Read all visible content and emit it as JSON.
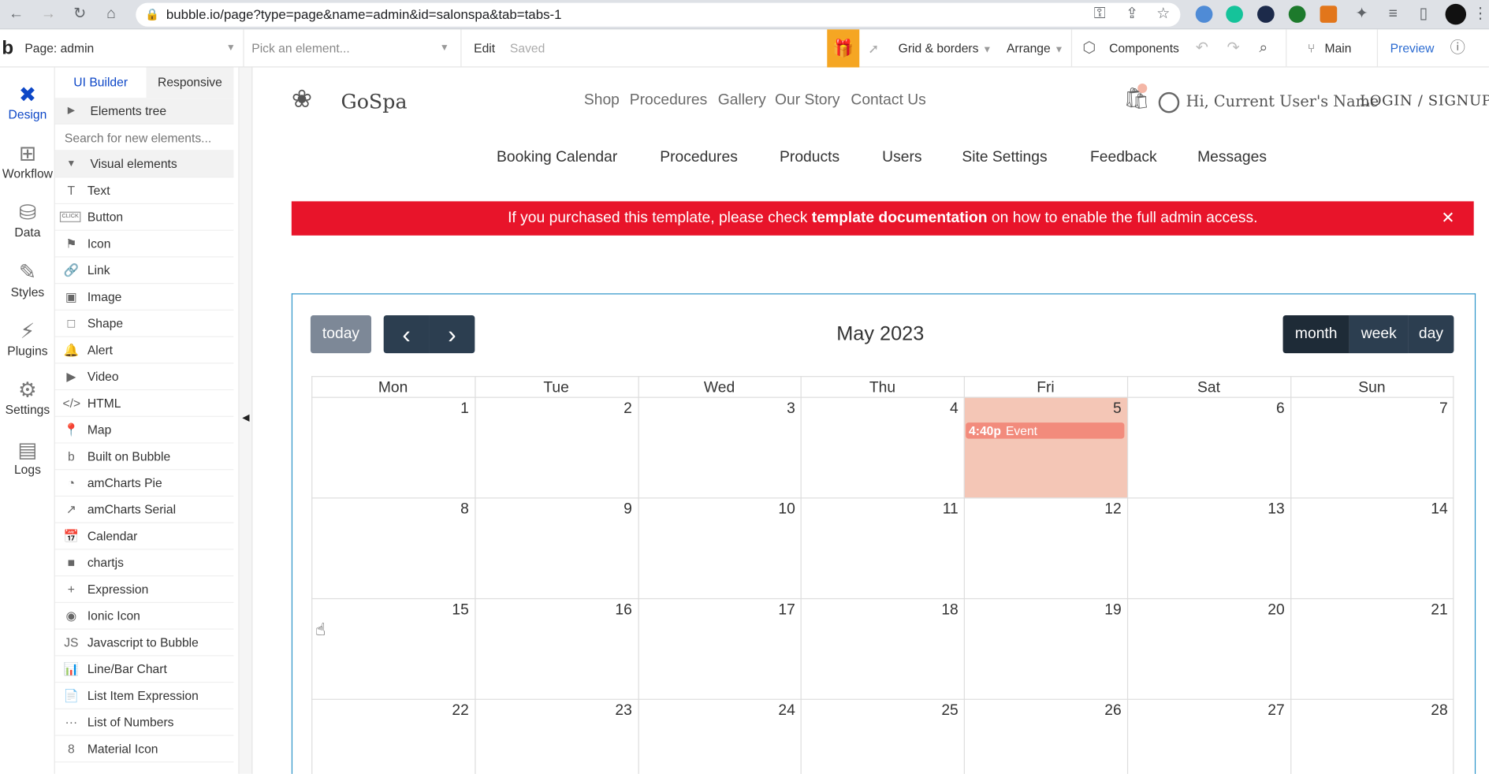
{
  "browser": {
    "url": "bubble.io/page?type=page&name=admin&id=salonspa&tab=tabs-1"
  },
  "toolbar": {
    "page_label": "Page: admin",
    "element_picker": "Pick an element...",
    "edit": "Edit",
    "saved": "Saved",
    "grid_borders": "Grid & borders",
    "arrange": "Arrange",
    "components": "Components",
    "branch": "Main",
    "preview": "Preview"
  },
  "leftnav": {
    "items": [
      "Design",
      "Workflow",
      "Data",
      "Styles",
      "Plugins",
      "Settings",
      "Logs"
    ]
  },
  "panel": {
    "tabs": [
      "UI Builder",
      "Responsive"
    ],
    "elements_tree": "Elements tree",
    "search_placeholder": "Search for new elements...",
    "visual_elements": "Visual elements",
    "items": [
      "Text",
      "Button",
      "Icon",
      "Link",
      "Image",
      "Shape",
      "Alert",
      "Video",
      "HTML",
      "Map",
      "Built on Bubble",
      "amCharts Pie",
      "amCharts Serial",
      "Calendar",
      "chartjs",
      "Expression",
      "Ionic Icon",
      "Javascript to Bubble",
      "Line/Bar Chart",
      "List Item Expression",
      "List of Numbers",
      "Material Icon"
    ],
    "icons": [
      "T",
      "CLICK",
      "⚑",
      "🔗",
      "▣",
      "□",
      "🔔",
      "▶",
      "</>",
      "📍",
      "b",
      "◔",
      "↗",
      "📅",
      "■",
      "+",
      "◉",
      "JS",
      "📊",
      "📄",
      "···",
      "8"
    ]
  },
  "site": {
    "logo": "GoSpa",
    "topnav": [
      "Shop",
      "Procedures",
      "Gallery",
      "Our Story",
      "Contact Us"
    ],
    "user_greeting": "Hi, Current User's Name",
    "login": "LOGIN",
    "slash": "/",
    "signup": "SIGNUP",
    "admin_tabs": [
      "Booking Calendar",
      "Procedures",
      "Products",
      "Users",
      "Site Settings",
      "Feedback",
      "Messages"
    ],
    "banner": {
      "before": "If you purchased this template, please check ",
      "bold": "template documentation",
      "after": " on how to enable the full admin access.",
      "close": "✕",
      "color": "#e8142a"
    }
  },
  "calendar": {
    "today": "today",
    "prev": "‹",
    "next": "›",
    "title": "May 2023",
    "views": [
      "month",
      "week",
      "day"
    ],
    "weekdays": [
      "Mon",
      "Tue",
      "Wed",
      "Thu",
      "Fri",
      "Sat",
      "Sun"
    ],
    "weeks": [
      [
        "1",
        "2",
        "3",
        "4",
        "5",
        "6",
        "7"
      ],
      [
        "8",
        "9",
        "10",
        "11",
        "12",
        "13",
        "14"
      ],
      [
        "15",
        "16",
        "17",
        "18",
        "19",
        "20",
        "21"
      ],
      [
        "22",
        "23",
        "24",
        "25",
        "26",
        "27",
        "28"
      ]
    ],
    "highlight_day": "5",
    "event": {
      "time": "4:40p",
      "title": "Event"
    }
  }
}
